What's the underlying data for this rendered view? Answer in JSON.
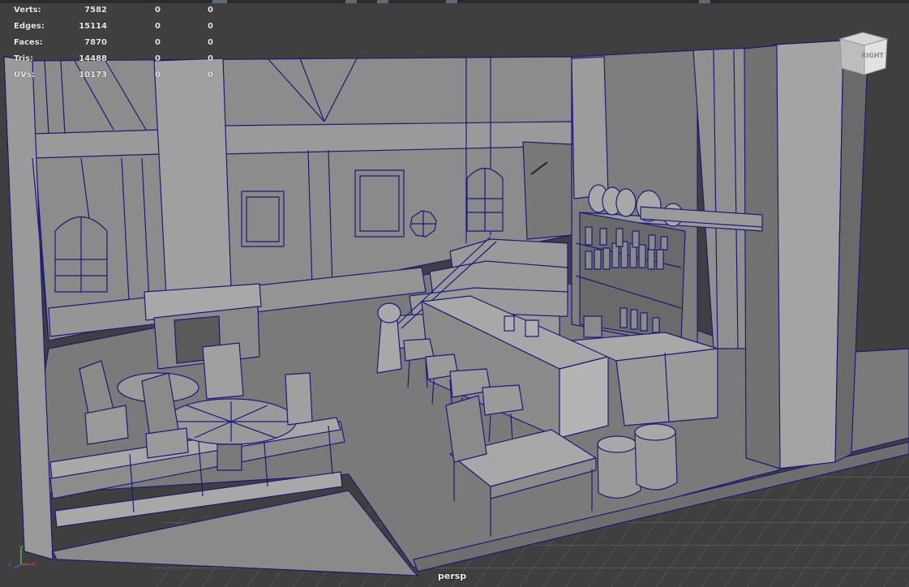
{
  "hud": {
    "rows": [
      {
        "label": "Verts:",
        "v1": "7582",
        "v2": "0",
        "v3": "0"
      },
      {
        "label": "Edges:",
        "v1": "15114",
        "v2": "0",
        "v3": "0"
      },
      {
        "label": "Faces:",
        "v1": "7870",
        "v2": "0",
        "v3": "0"
      },
      {
        "label": "Tris:",
        "v1": "14488",
        "v2": "0",
        "v3": "0"
      },
      {
        "label": "UVs:",
        "v1": "10173",
        "v2": "0",
        "v3": "0"
      }
    ]
  },
  "viewcube": {
    "face_label": "RIGHT"
  },
  "camera": {
    "name": "persp"
  },
  "axis": {
    "y": "y",
    "z": "z",
    "x": "x"
  },
  "colors": {
    "background": "#3f3f3f",
    "wire": "#1a1a7a",
    "face_light": "#9a9a9a",
    "face_mid": "#808080",
    "face_dark": "#5e5e5e"
  }
}
